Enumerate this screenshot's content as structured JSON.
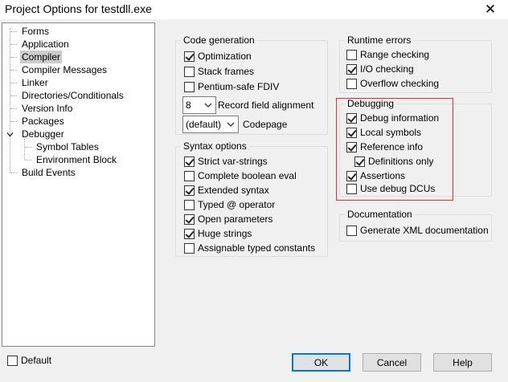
{
  "window": {
    "title": "Project Options for testdll.exe",
    "close_glyph": "✕"
  },
  "tree": {
    "items": [
      {
        "label": "Forms"
      },
      {
        "label": "Application"
      },
      {
        "label": "Compiler",
        "selected": true
      },
      {
        "label": "Compiler Messages"
      },
      {
        "label": "Linker"
      },
      {
        "label": "Directories/Conditionals"
      },
      {
        "label": "Version Info"
      },
      {
        "label": "Packages"
      },
      {
        "label": "Debugger",
        "expanded": true
      },
      {
        "label": "Symbol Tables"
      },
      {
        "label": "Environment Block"
      },
      {
        "label": "Build Events"
      }
    ]
  },
  "code_generation": {
    "title": "Code generation",
    "optimization": {
      "label": "Optimization",
      "checked": true
    },
    "stack_frames": {
      "label": "Stack frames",
      "checked": false
    },
    "pentium_fdiv": {
      "label": "Pentium-safe FDIV",
      "checked": false
    },
    "record_alignment": {
      "value": "8",
      "label": "Record field alignment"
    },
    "codepage": {
      "value": "(default)",
      "label": "Codepage"
    }
  },
  "syntax_options": {
    "title": "Syntax options",
    "items": [
      {
        "label": "Strict var-strings",
        "checked": true
      },
      {
        "label": "Complete boolean eval",
        "checked": false
      },
      {
        "label": "Extended syntax",
        "checked": true
      },
      {
        "label": "Typed @ operator",
        "checked": false
      },
      {
        "label": "Open parameters",
        "checked": true
      },
      {
        "label": "Huge strings",
        "checked": true
      },
      {
        "label": "Assignable typed constants",
        "checked": false
      }
    ]
  },
  "runtime_errors": {
    "title": "Runtime errors",
    "items": [
      {
        "label": "Range checking",
        "checked": false
      },
      {
        "label": "I/O checking",
        "checked": true
      },
      {
        "label": "Overflow checking",
        "checked": false
      }
    ]
  },
  "debugging": {
    "title": "Debugging",
    "items": [
      {
        "label": "Debug information",
        "checked": true
      },
      {
        "label": "Local symbols",
        "checked": true
      },
      {
        "label": "Reference info",
        "checked": true
      },
      {
        "label": "Definitions only",
        "checked": true
      },
      {
        "label": "Assertions",
        "checked": true
      },
      {
        "label": "Use debug DCUs",
        "checked": false
      }
    ]
  },
  "documentation": {
    "title": "Documentation",
    "generate_xml": {
      "label": "Generate XML documentation",
      "checked": false
    }
  },
  "footer": {
    "default": {
      "label": "Default",
      "checked": false
    },
    "ok_label": "OK",
    "cancel_label": "Cancel",
    "help_label": "Help"
  },
  "colors": {
    "highlight_border": "#e03131",
    "selected_item": "#cccccc",
    "default_button_border": "#0078d7"
  }
}
